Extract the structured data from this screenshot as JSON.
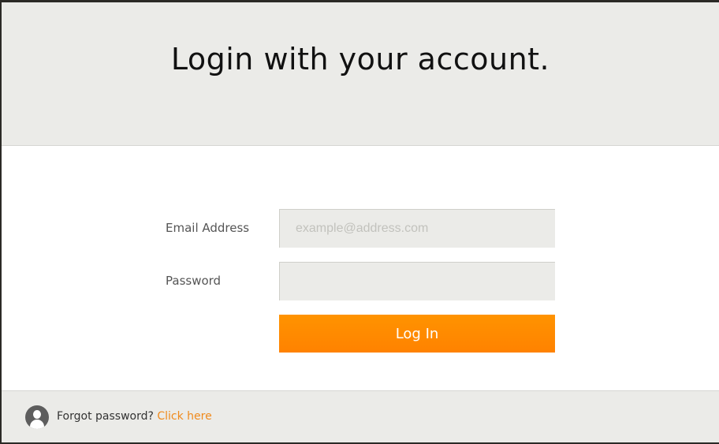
{
  "header": {
    "title": "Login with your account."
  },
  "form": {
    "email_label": "Email Address",
    "email_placeholder": "example@address.com",
    "email_value": "",
    "password_label": "Password",
    "password_value": "",
    "login_button": "Log In"
  },
  "footer": {
    "icon": "user-icon",
    "forgot_text": "Forgot password?",
    "click_here_link": "Click here"
  },
  "colors": {
    "accent": "#ff8a00",
    "link": "#f08a1c",
    "panel_background": "#ebebe8"
  }
}
